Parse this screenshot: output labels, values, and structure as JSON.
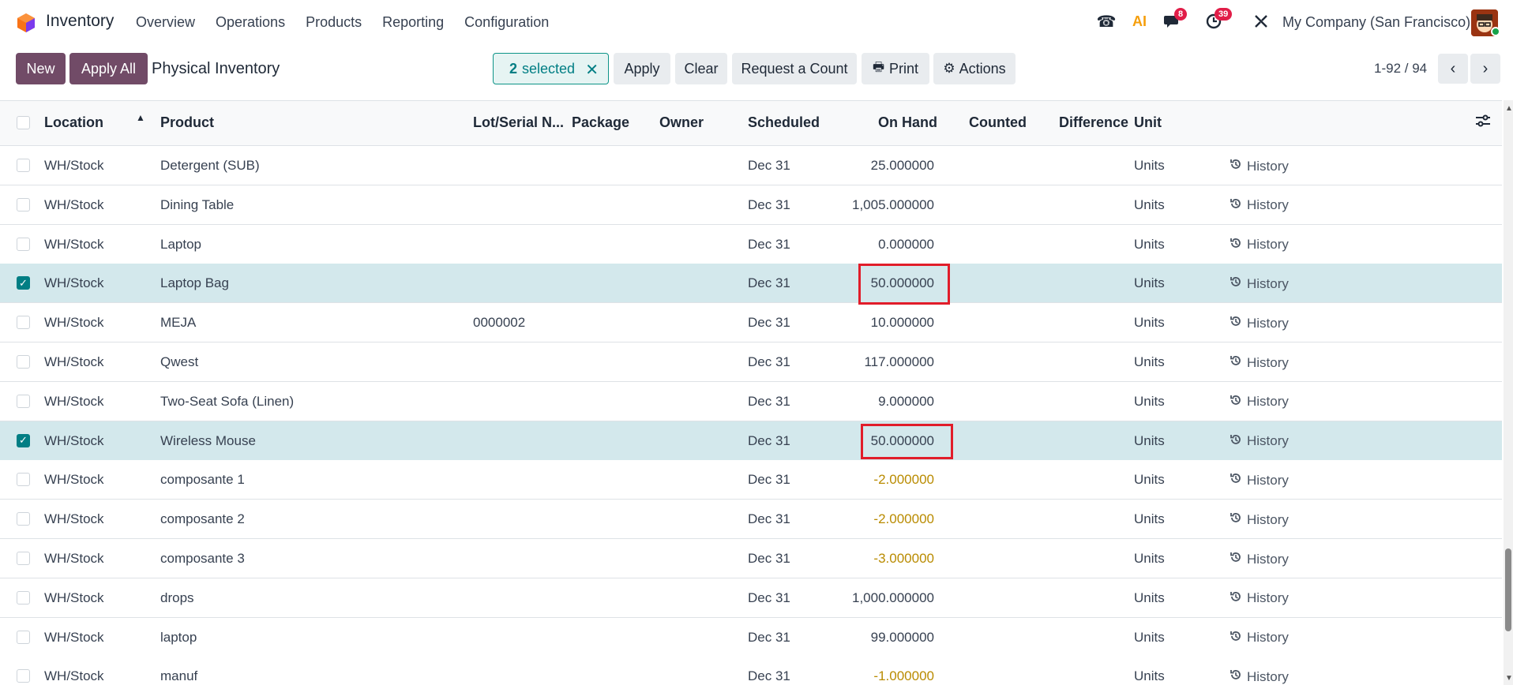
{
  "nav": {
    "app_name": "Inventory",
    "menu": [
      "Overview",
      "Operations",
      "Products",
      "Reporting",
      "Configuration"
    ],
    "messages_badge": "8",
    "activities_badge": "39",
    "ai_label": "AI",
    "company": "My Company (San Francisco)"
  },
  "control": {
    "new_label": "New",
    "apply_all_label": "Apply All",
    "title": "Physical Inventory",
    "selected_count": "2",
    "selected_text": "selected",
    "apply_label": "Apply",
    "clear_label": "Clear",
    "request_count_label": "Request a Count",
    "print_label": "Print",
    "actions_label": "Actions",
    "pager": "1-92 / 94"
  },
  "table": {
    "headers": {
      "location": "Location",
      "product": "Product",
      "lot": "Lot/Serial N...",
      "package": "Package",
      "owner": "Owner",
      "scheduled": "Scheduled",
      "on_hand": "On Hand",
      "counted": "Counted",
      "difference": "Difference",
      "unit": "Unit"
    },
    "history_label": "History",
    "rows": [
      {
        "location": "WH/Stock",
        "product": "Detergent (SUB)",
        "lot": "",
        "scheduled": "Dec 31",
        "on_hand": "25.000000",
        "unit": "Units",
        "selected": false,
        "negative": false
      },
      {
        "location": "WH/Stock",
        "product": "Dining Table",
        "lot": "",
        "scheduled": "Dec 31",
        "on_hand": "1,005.000000",
        "unit": "Units",
        "selected": false,
        "negative": false
      },
      {
        "location": "WH/Stock",
        "product": "Laptop",
        "lot": "",
        "scheduled": "Dec 31",
        "on_hand": "0.000000",
        "unit": "Units",
        "selected": false,
        "negative": false
      },
      {
        "location": "WH/Stock",
        "product": "Laptop Bag",
        "lot": "",
        "scheduled": "Dec 31",
        "on_hand": "50.000000",
        "unit": "Units",
        "selected": true,
        "negative": false
      },
      {
        "location": "WH/Stock",
        "product": "MEJA",
        "lot": "0000002",
        "scheduled": "Dec 31",
        "on_hand": "10.000000",
        "unit": "Units",
        "selected": false,
        "negative": false
      },
      {
        "location": "WH/Stock",
        "product": "Qwest",
        "lot": "",
        "scheduled": "Dec 31",
        "on_hand": "117.000000",
        "unit": "Units",
        "selected": false,
        "negative": false
      },
      {
        "location": "WH/Stock",
        "product": "Two-Seat Sofa (Linen)",
        "lot": "",
        "scheduled": "Dec 31",
        "on_hand": "9.000000",
        "unit": "Units",
        "selected": false,
        "negative": false
      },
      {
        "location": "WH/Stock",
        "product": "Wireless Mouse",
        "lot": "",
        "scheduled": "Dec 31",
        "on_hand": "50.000000",
        "unit": "Units",
        "selected": true,
        "negative": false
      },
      {
        "location": "WH/Stock",
        "product": "composante 1",
        "lot": "",
        "scheduled": "Dec 31",
        "on_hand": "-2.000000",
        "unit": "Units",
        "selected": false,
        "negative": true
      },
      {
        "location": "WH/Stock",
        "product": "composante 2",
        "lot": "",
        "scheduled": "Dec 31",
        "on_hand": "-2.000000",
        "unit": "Units",
        "selected": false,
        "negative": true
      },
      {
        "location": "WH/Stock",
        "product": "composante 3",
        "lot": "",
        "scheduled": "Dec 31",
        "on_hand": "-3.000000",
        "unit": "Units",
        "selected": false,
        "negative": true
      },
      {
        "location": "WH/Stock",
        "product": "drops",
        "lot": "",
        "scheduled": "Dec 31",
        "on_hand": "1,000.000000",
        "unit": "Units",
        "selected": false,
        "negative": false
      },
      {
        "location": "WH/Stock",
        "product": "laptop",
        "lot": "",
        "scheduled": "Dec 31",
        "on_hand": "99.000000",
        "unit": "Units",
        "selected": false,
        "negative": false
      },
      {
        "location": "WH/Stock",
        "product": "manuf",
        "lot": "",
        "scheduled": "Dec 31",
        "on_hand": "-1.000000",
        "unit": "Units",
        "selected": false,
        "negative": true
      }
    ]
  }
}
